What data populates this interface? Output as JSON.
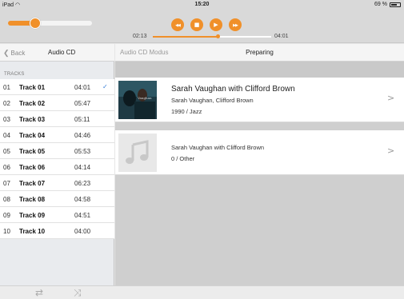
{
  "status_bar": {
    "device": "iPad",
    "time": "15:20",
    "battery": "69 %",
    "battery_level": 0.69
  },
  "player": {
    "volume_level": 0.32,
    "elapsed": "02:13",
    "total": "04:01",
    "progress": 0.55,
    "controls": {
      "previous": "◀◀",
      "stop": "■",
      "play": "▶",
      "next": "▶▶"
    },
    "accent_color": "#f0902a"
  },
  "left_panel": {
    "back_label": "Back",
    "title": "Audio CD",
    "section_label": "TRACKS",
    "tracks": [
      {
        "num": "01",
        "name": "Track 01",
        "duration": "04:01",
        "selected": true
      },
      {
        "num": "02",
        "name": "Track 02",
        "duration": "05:47",
        "selected": false
      },
      {
        "num": "03",
        "name": "Track 03",
        "duration": "05:11",
        "selected": false
      },
      {
        "num": "04",
        "name": "Track 04",
        "duration": "04:46",
        "selected": false
      },
      {
        "num": "05",
        "name": "Track 05",
        "duration": "05:53",
        "selected": false
      },
      {
        "num": "06",
        "name": "Track 06",
        "duration": "04:14",
        "selected": false
      },
      {
        "num": "07",
        "name": "Track 07",
        "duration": "06:23",
        "selected": false
      },
      {
        "num": "08",
        "name": "Track 08",
        "duration": "04:58",
        "selected": false
      },
      {
        "num": "09",
        "name": "Track 09",
        "duration": "04:51",
        "selected": false
      },
      {
        "num": "10",
        "name": "Track 10",
        "duration": "04:00",
        "selected": false
      }
    ],
    "check_mark": "✓"
  },
  "right_panel": {
    "mode_label": "Audio CD Modus",
    "status_label": "Preparing",
    "albums": [
      {
        "title": "Sarah Vaughan with Clifford Brown",
        "artist": "Sarah Vaughan, Clifford Brown",
        "meta": "1990  /  Jazz",
        "cover": "album-art",
        "arrow": ">"
      },
      {
        "title": "",
        "artist": "Sarah Vaughan with Clifford Brown",
        "meta": "0  /  Other",
        "cover": "music-note-placeholder",
        "arrow": ">"
      }
    ]
  },
  "bottom_bar": {
    "repeat_icon": "⇄",
    "shuffle_icon": "⤨"
  }
}
